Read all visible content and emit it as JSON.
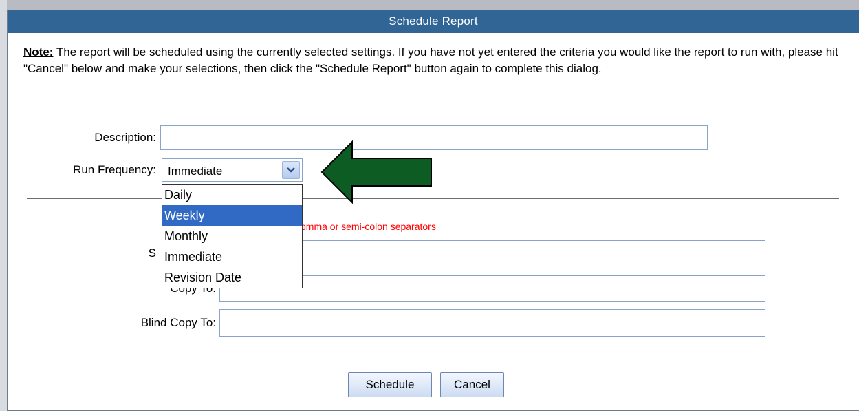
{
  "dialog": {
    "title": "Schedule Report"
  },
  "note": {
    "label": "Note:",
    "text": " The report will be scheduled using the currently selected settings. If you have not yet entered the criteria you would like the report to run with, please hit \"Cancel\" below and make your selections, then click the \"Schedule Report\" button again to complete this dialog."
  },
  "form": {
    "description_label": "Description:",
    "description_value": "",
    "run_frequency_label": "Run Frequency:",
    "run_frequency_value": "Immediate",
    "run_frequency_options": [
      "Daily",
      "Weekly",
      "Monthly",
      "Immediate",
      "Revision Date"
    ],
    "highlighted_option": "Weekly",
    "email_hint": "dresses can be entered with comma or semi-colon separators",
    "send_to_label_partial": "S",
    "send_to_value": "",
    "copy_to_label": "Copy To:",
    "copy_to_value": "",
    "blind_copy_to_label": "Blind Copy To:",
    "blind_copy_to_value": ""
  },
  "buttons": {
    "schedule": "Schedule",
    "cancel": "Cancel"
  },
  "colors": {
    "titlebar": "#316596",
    "arrow": "#0d5c23",
    "hint": "#ff0000",
    "selection": "#316ac5"
  },
  "icons": {
    "dropdown_arrow": "chevron-down-icon",
    "pointer_arrow": "left-arrow-icon"
  }
}
